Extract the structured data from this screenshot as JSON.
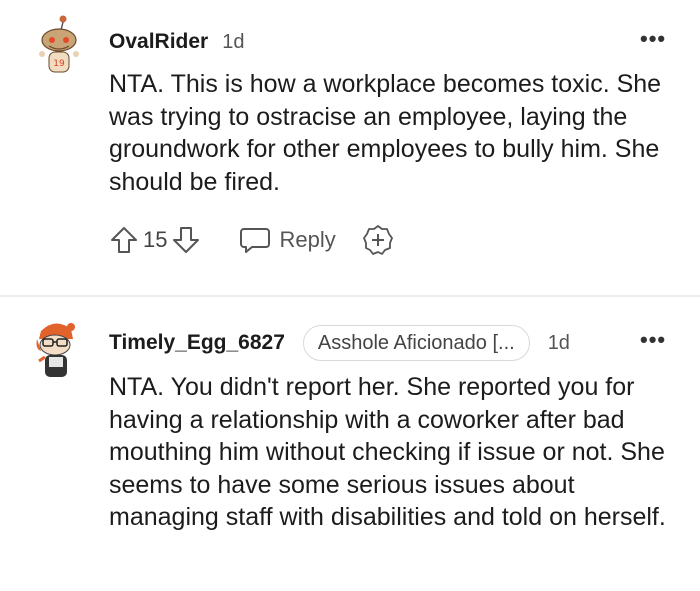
{
  "comments": [
    {
      "username": "OvalRider",
      "time": "1d",
      "text": "NTA. This is how a workplace becomes toxic. She was trying to ostracise an employee, laying the groundwork for other employees to bully him. She should be fired.",
      "votes": "15",
      "reply_label": "Reply",
      "more_icon": "more-horizontal-icon"
    },
    {
      "username": "Timely_Egg_6827",
      "flair": "Asshole Aficionado [...",
      "time": "1d",
      "text": "NTA. You didn't report her. She reported you for having a relationship with a coworker after bad mouthing him without checking if issue or not. She seems to have some serious issues about managing staff with disabilities and told on herself.",
      "more_icon": "more-horizontal-icon"
    }
  ],
  "colors": {
    "text": "#1c1c1c",
    "muted": "#555555",
    "divider": "#ececec",
    "flair_border": "#d9d9d9"
  }
}
